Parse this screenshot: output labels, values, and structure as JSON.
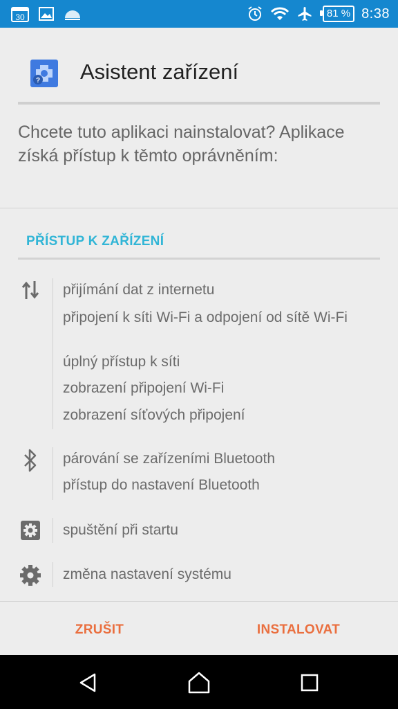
{
  "status_bar": {
    "calendar_day": "30",
    "battery": "81 %",
    "time": "8:38"
  },
  "dialog": {
    "app_name": "Asistent zařízení",
    "question": "Chcete tuto aplikaci nainstalovat? Aplikace získá přístup k těmto oprávněním:",
    "section_title": "PŘÍSTUP K ZAŘÍZENÍ",
    "groups": [
      {
        "icon": "data-transfer-icon",
        "permissions": [
          "přijímání dat z internetu",
          "připojení k síti Wi-Fi a odpojení od sítě Wi-Fi",
          "úplný přístup k síti",
          "zobrazení připojení Wi-Fi",
          "zobrazení síťových připojení"
        ]
      },
      {
        "icon": "bluetooth-icon",
        "permissions": [
          "párování se zařízeními Bluetooth",
          "přístup do nastavení Bluetooth"
        ]
      },
      {
        "icon": "settings-box-icon",
        "permissions": [
          "spuštění při startu"
        ]
      },
      {
        "icon": "gear-icon",
        "permissions": [
          "změna nastavení systému"
        ]
      }
    ],
    "cancel_label": "ZRUŠIT",
    "install_label": "INSTALOVAT"
  }
}
